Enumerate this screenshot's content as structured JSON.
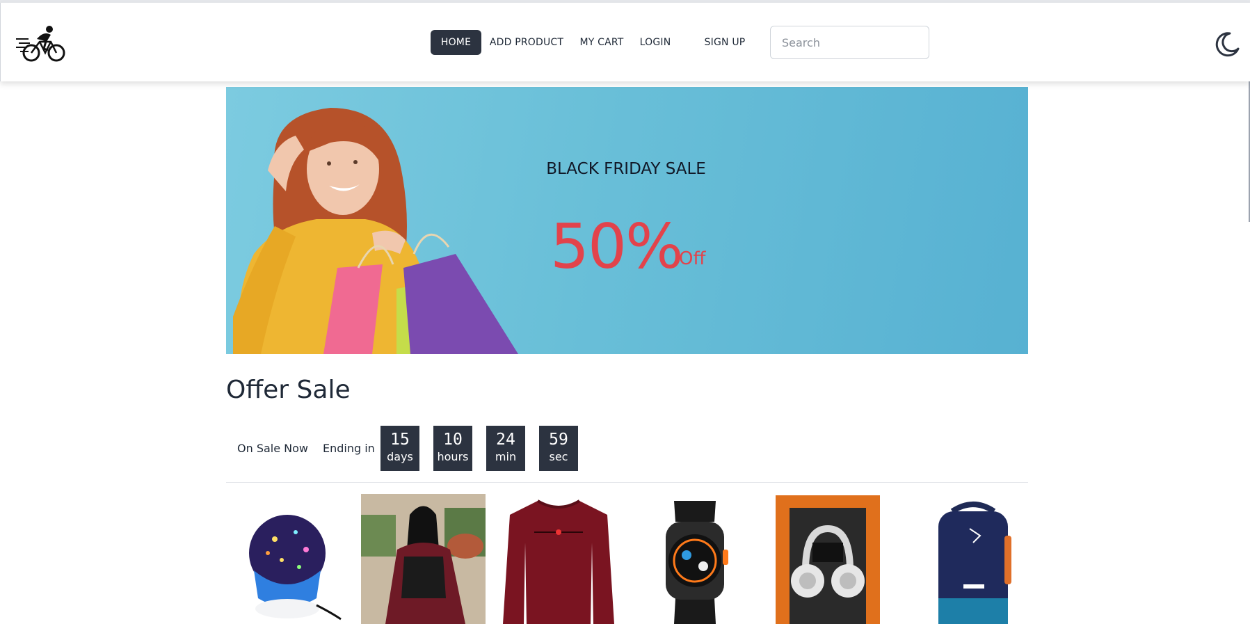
{
  "nav": {
    "logo_icon": "cyclist-logo-icon",
    "links": [
      {
        "label": "HOME",
        "active": true
      },
      {
        "label": "ADD PRODUCT",
        "active": false
      },
      {
        "label": "MY CART",
        "active": false
      },
      {
        "label": "LOGIN",
        "active": false
      },
      {
        "label": "SIGN UP",
        "active": false
      }
    ],
    "search_placeholder": "Search",
    "theme_icon": "moon-icon"
  },
  "hero": {
    "title": "BLACK FRIDAY SALE",
    "discount": "50%",
    "off": "Off",
    "accent_color": "#e2434b",
    "background_color": "#62bad6"
  },
  "offer": {
    "heading": "Offer Sale",
    "on_sale": "On Sale Now",
    "ending": "Ending in",
    "countdown": [
      {
        "value": "15",
        "unit": "days"
      },
      {
        "value": "10",
        "unit": "hours"
      },
      {
        "value": "24",
        "unit": "min"
      },
      {
        "value": "59",
        "unit": "sec"
      }
    ]
  },
  "products": [
    {
      "icon": "star-projector-lamp-image"
    },
    {
      "icon": "hijab-abaya-image"
    },
    {
      "icon": "maroon-tshirt-image"
    },
    {
      "icon": "smartwatch-image"
    },
    {
      "icon": "headphones-box-image"
    },
    {
      "icon": "sports-backpack-image"
    }
  ],
  "colors": {
    "dark": "#2c3340",
    "text": "#1f2937"
  }
}
